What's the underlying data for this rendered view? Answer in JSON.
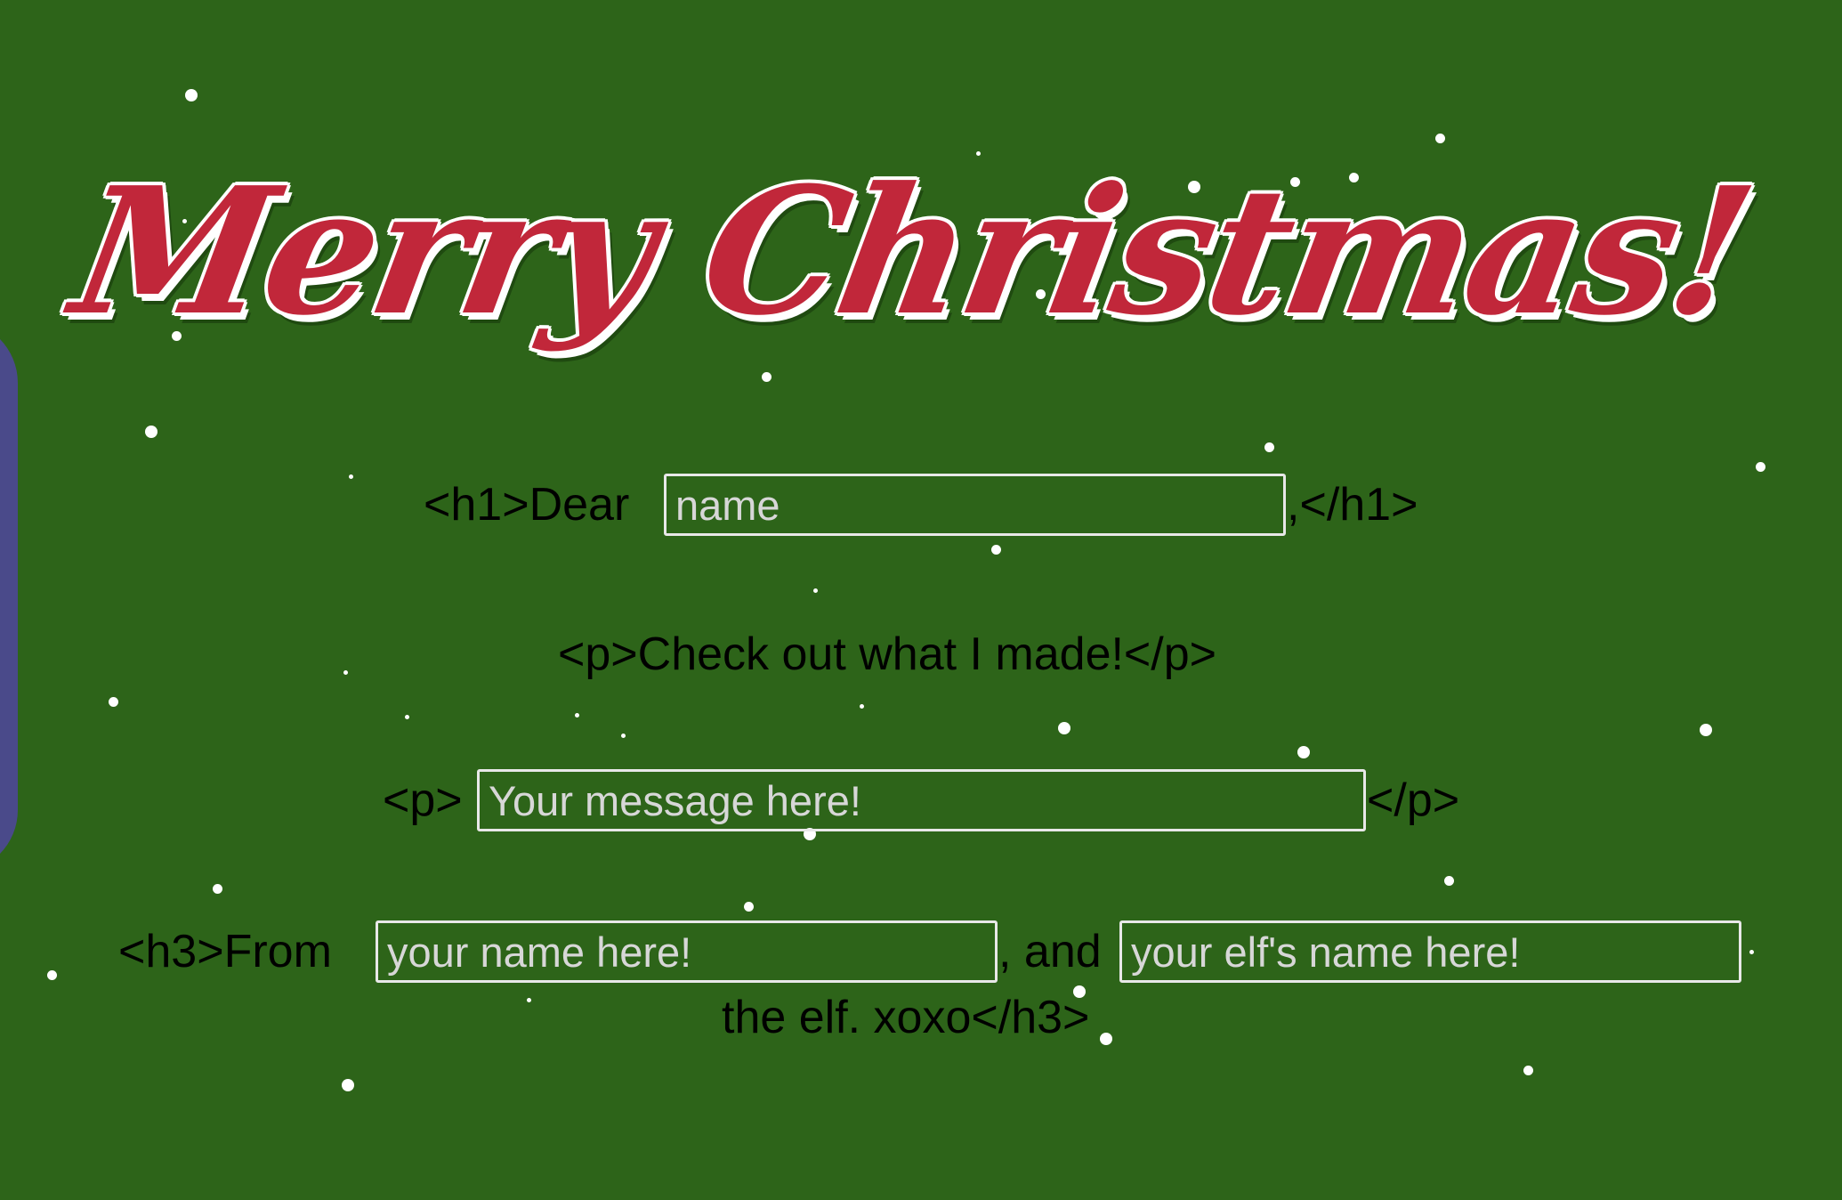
{
  "colors": {
    "background": "#2d6419",
    "title": "#c1273a",
    "side_panel": "#4a4a8a",
    "field_border": "#e8e8e8",
    "text": "#000000"
  },
  "title": "Merry Christmas!",
  "greeting": {
    "prefix": "<h1>Dear",
    "name_placeholder": "name",
    "suffix": ",</h1>"
  },
  "intro": "<p>Check out what I made!</p>",
  "message": {
    "prefix": "<p>",
    "placeholder": "Your message here!",
    "suffix": "</p>"
  },
  "signoff": {
    "prefix": "<h3>From",
    "your_name_placeholder": "your name here!",
    "joiner": ", and",
    "elf_name_placeholder": "your elf's name here!",
    "closing": "the elf. xoxo</h3>"
  }
}
